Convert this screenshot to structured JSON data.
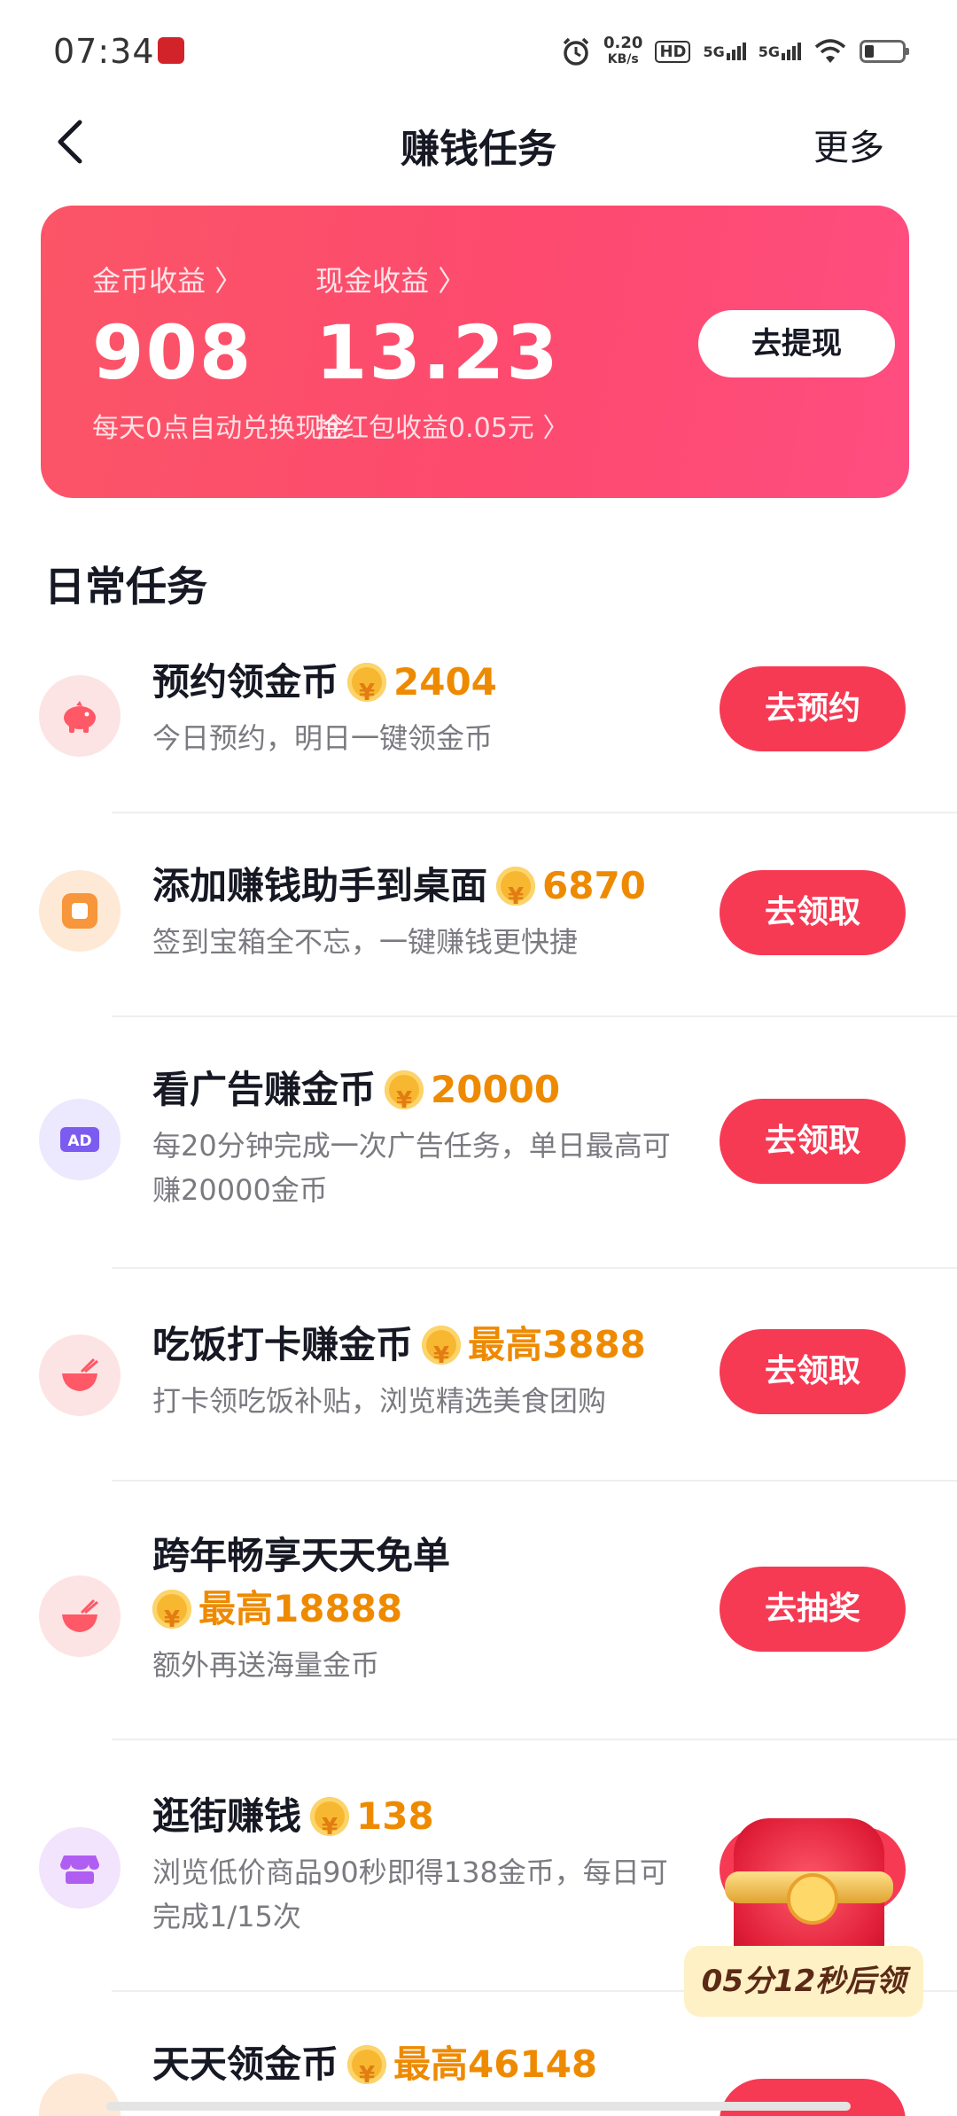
{
  "status_bar": {
    "time": "07:34",
    "net_speed_value": "0.20",
    "net_speed_unit": "KB/s",
    "hd_label": "HD",
    "signal_1": "5G",
    "signal_2": "5G"
  },
  "nav": {
    "title": "赚钱任务",
    "more_label": "更多"
  },
  "earnings": {
    "coin_label": "金币收益 〉",
    "coin_value": "908",
    "coin_sub": "每天0点自动兑换现金",
    "cash_label": "现金收益 〉",
    "cash_value": "13.23",
    "cash_sub": "抢红包收益0.05元 〉",
    "withdraw_label": "去提现"
  },
  "section_title": "日常任务",
  "tasks": [
    {
      "title": "预约领金币",
      "reward": "2404",
      "desc": "今日预约，明日一键领金币",
      "button": "去预约",
      "icon": "piggy-bank-icon",
      "color": "#ff5866"
    },
    {
      "title": "添加赚钱助手到桌面",
      "reward": "6870",
      "desc": "签到宝箱全不忘，一键赚钱更快捷",
      "button": "去领取",
      "icon": "app-square-icon",
      "color": "#f7963a"
    },
    {
      "title": "看广告赚金币",
      "reward": "20000",
      "desc": "每20分钟完成一次广告任务，单日最高可赚20000金币",
      "button": "去领取",
      "icon": "ad-icon",
      "color": "#7b5bf0"
    },
    {
      "title": "吃饭打卡赚金币",
      "reward": "最高3888",
      "desc": "打卡领吃饭补贴，浏览精选美食团购",
      "button": "去领取",
      "icon": "rice-bowl-icon",
      "color": "#ff5866"
    },
    {
      "title": "跨年畅享天天免单",
      "reward": "最高18888",
      "desc": "额外再送海量金币",
      "button": "去抽奖",
      "icon": "rice-bowl-icon",
      "color": "#ff5866"
    },
    {
      "title": "逛街赚钱",
      "reward": "138",
      "desc": "浏览低价商品90秒即得138金币，每日可完成1/15次",
      "button": "",
      "icon": "store-icon",
      "color": "#b05ef2"
    },
    {
      "title": "天天领金币",
      "reward": "最高46148",
      "desc": "",
      "button": "",
      "icon": "coin-icon",
      "color": "#f7963a"
    }
  ],
  "chest": {
    "timer_label": "05分12秒后领"
  },
  "coin_symbol": "¥",
  "colors": {
    "accent": "#f73a54",
    "card_start": "#fb5567",
    "card_end": "#fe4d80",
    "reward": "#ee8a00"
  }
}
